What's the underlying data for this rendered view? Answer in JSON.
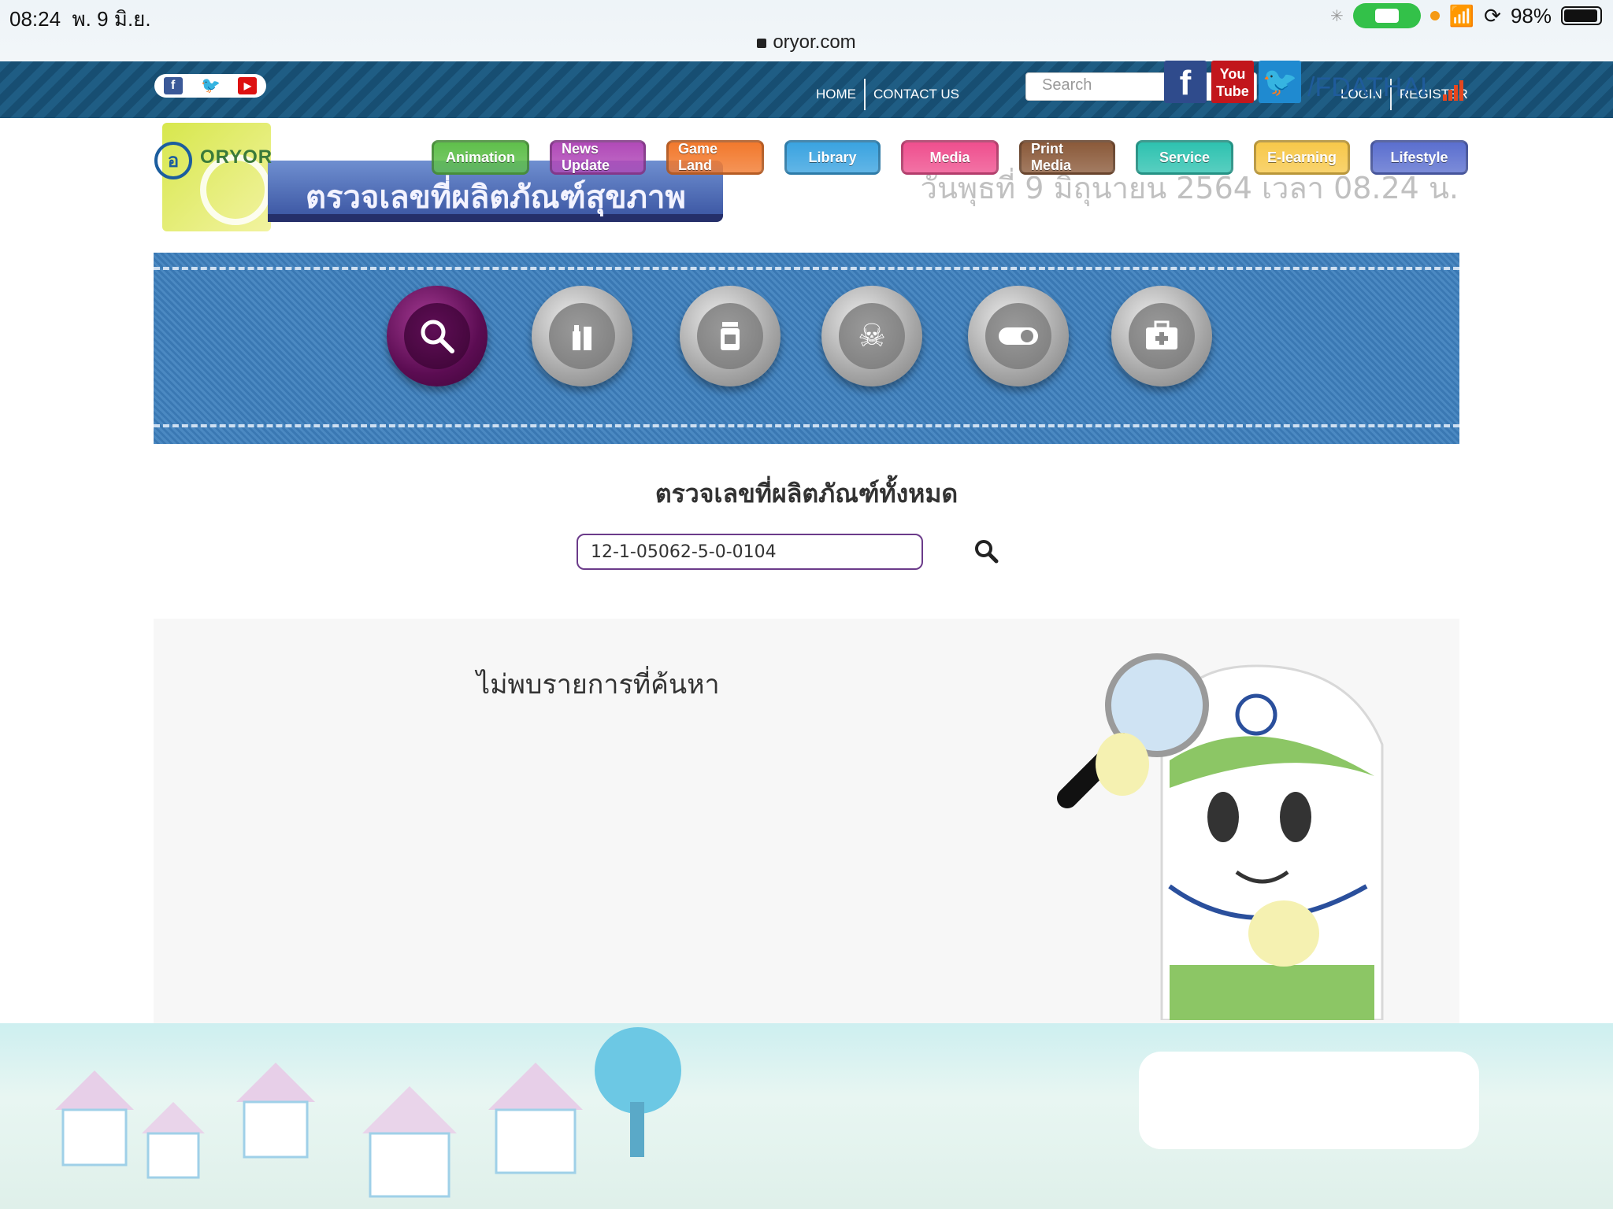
{
  "statusbar": {
    "time": "08:24",
    "date": "พ. 9 มิ.ย.",
    "battery": "98%",
    "url": "oryor.com"
  },
  "topnav": {
    "home": "HOME",
    "contact": "CONTACT US",
    "search_placeholder": "Search",
    "login": "LOGIN",
    "register": "REGISTER"
  },
  "header": {
    "logo_text": "ORYOR",
    "banner_title": "ตรวจเลขที่ผลิตภัณฑ์สุขภาพ",
    "date_text": "วันพุธที่ 9 มิถุนายน 2564 เวลา 08.24 น.",
    "menu": [
      {
        "label": "Animation",
        "color": "#5fbf4b"
      },
      {
        "label": "News Update",
        "color": "#b14ab8"
      },
      {
        "label": "Game Land",
        "color": "#f2792d"
      },
      {
        "label": "Library",
        "color": "#3aa3e0"
      },
      {
        "label": "Media",
        "color": "#ef4f8e"
      },
      {
        "label": "Print Media",
        "color": "#8b5a3a"
      },
      {
        "label": "Service",
        "color": "#2ec2b0"
      },
      {
        "label": "E-learning",
        "color": "#f7c84a"
      },
      {
        "label": "Lifestyle",
        "color": "#5b6fcf"
      }
    ]
  },
  "categories": [
    {
      "icon": "search-icon",
      "active": true
    },
    {
      "icon": "cosmetics-icon",
      "active": false
    },
    {
      "icon": "medicine-bottle-icon",
      "active": false
    },
    {
      "icon": "skull-icon",
      "active": false
    },
    {
      "icon": "toggle-icon",
      "active": false
    },
    {
      "icon": "first-aid-kit-icon",
      "active": false
    }
  ],
  "search": {
    "title": "ตรวจเลขที่ผลิตภัณฑ์ทั้งหมด",
    "value": "12-1-05062-5-0-0104"
  },
  "result": {
    "message": "ไม่พบรายการที่ค้นหา"
  },
  "footer": {
    "handle": "/FDATHAI",
    "youtube_label_1": "You",
    "youtube_label_2": "Tube"
  }
}
